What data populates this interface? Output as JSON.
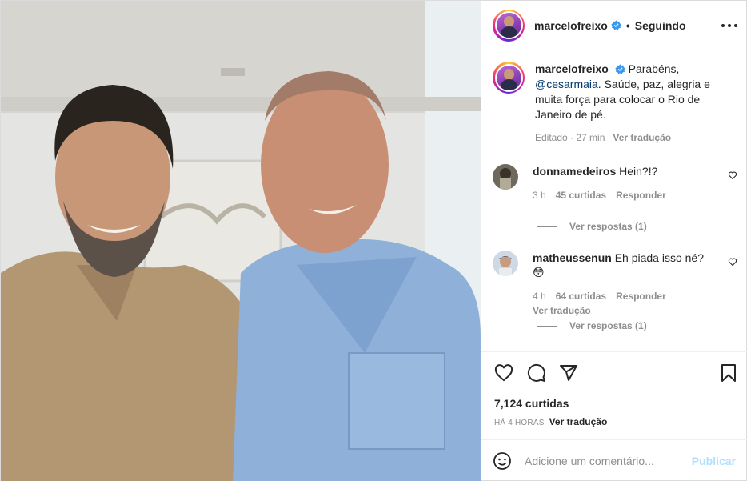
{
  "post": {
    "author": "marcelofreixo",
    "follow_status": "Seguindo",
    "caption_prefix": "Parabéns, ",
    "caption_mention": "@cesarmaia",
    "caption_suffix": ". Saúde, paz, alegria e muita força para colocar o Rio de Janeiro de pé.",
    "caption_edited": "Editado · 27 min",
    "caption_translate": "Ver tradução"
  },
  "comments": [
    {
      "username": "donnamedeiros",
      "text": "Hein?!?",
      "time": "3 h",
      "likes": "45 curtidas",
      "reply": "Responder",
      "translate": "",
      "view_replies": "Ver respostas (1)"
    },
    {
      "username": "matheussenun",
      "text": "Eh piada isso né? 😳",
      "time": "4 h",
      "likes": "64 curtidas",
      "reply": "Responder",
      "translate": "Ver tradução",
      "view_replies": "Ver respostas (1)"
    }
  ],
  "stats": {
    "likes": "7,124 curtidas",
    "time_ago": "HÁ 4 HORAS",
    "translate": "Ver tradução"
  },
  "composer": {
    "placeholder": "Adicione um comentário...",
    "post_label": "Publicar"
  },
  "icons": {
    "like": "heart-icon",
    "comment": "comment-icon",
    "share": "share-icon",
    "save": "bookmark-icon",
    "more": "more-options-icon",
    "verified": "verified-badge-icon",
    "emoji": "emoji-icon"
  },
  "colors": {
    "verified": "#3897f0",
    "mention": "#00376b",
    "post_button_disabled": "#b2dffc",
    "muted_text": "#8e8e8e"
  }
}
